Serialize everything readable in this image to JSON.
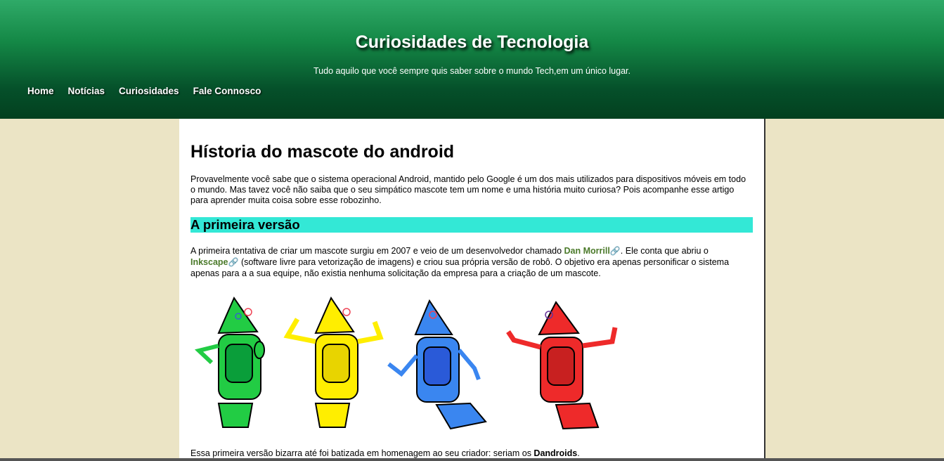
{
  "header": {
    "title": "Curiosidades de Tecnologia",
    "subtitle": "Tudo aquilo que você sempre quis saber sobre o mundo Tech,em um único lugar."
  },
  "nav": [
    {
      "label": "Home"
    },
    {
      "label": "Notícias"
    },
    {
      "label": "Curiosidades"
    },
    {
      "label": "Fale Connosco"
    }
  ],
  "article": {
    "title": "Hístoria do mascote do android",
    "intro": "Provavelmente você sabe que o sistema operacional Android, mantido pelo Google é um dos mais utilizados para dispositivos móveis em todo o mundo. Mas tavez você não saiba que o seu simpático mascote tem um nome e uma história muito curiosa? Pois acompanhe esse artigo para aprender muita coisa sobre esse robozinho.",
    "section_title": "A primeira versão",
    "p1_a": "A primeira tentativa de criar um mascote surgiu em 2007 e veio de um desenvolvedor chamado ",
    "link1": "Dan Morrill",
    "p1_b": ". Ele conta que abriu o ",
    "link2": "Inkscape",
    "p1_c": " (software livre para vetorização de imagens) e criou sua própria versão de robô. O objetivo era apenas personificar o sistema apenas para a a sua equipe, não existia nenhuma solicitação da empresa para a criação de um mascote.",
    "p2_a": "Essa primeira versão bizarra até foi batizada em homenagem ao seu criador: seriam os ",
    "p2_bold": "Dandroids",
    "p2_c": "."
  },
  "colors": {
    "header_top": "#2faa68",
    "header_bottom": "#03401f",
    "page_bg": "#ebe4c5",
    "section_bg": "#33e8d6",
    "link": "#4b7a2a"
  },
  "robots": [
    {
      "color": "green-robot",
      "fill": "#22cc44"
    },
    {
      "color": "yellow-robot",
      "fill": "#ffee00"
    },
    {
      "color": "blue-robot",
      "fill": "#3a86f0"
    },
    {
      "color": "red-robot",
      "fill": "#ee2a2a"
    }
  ]
}
